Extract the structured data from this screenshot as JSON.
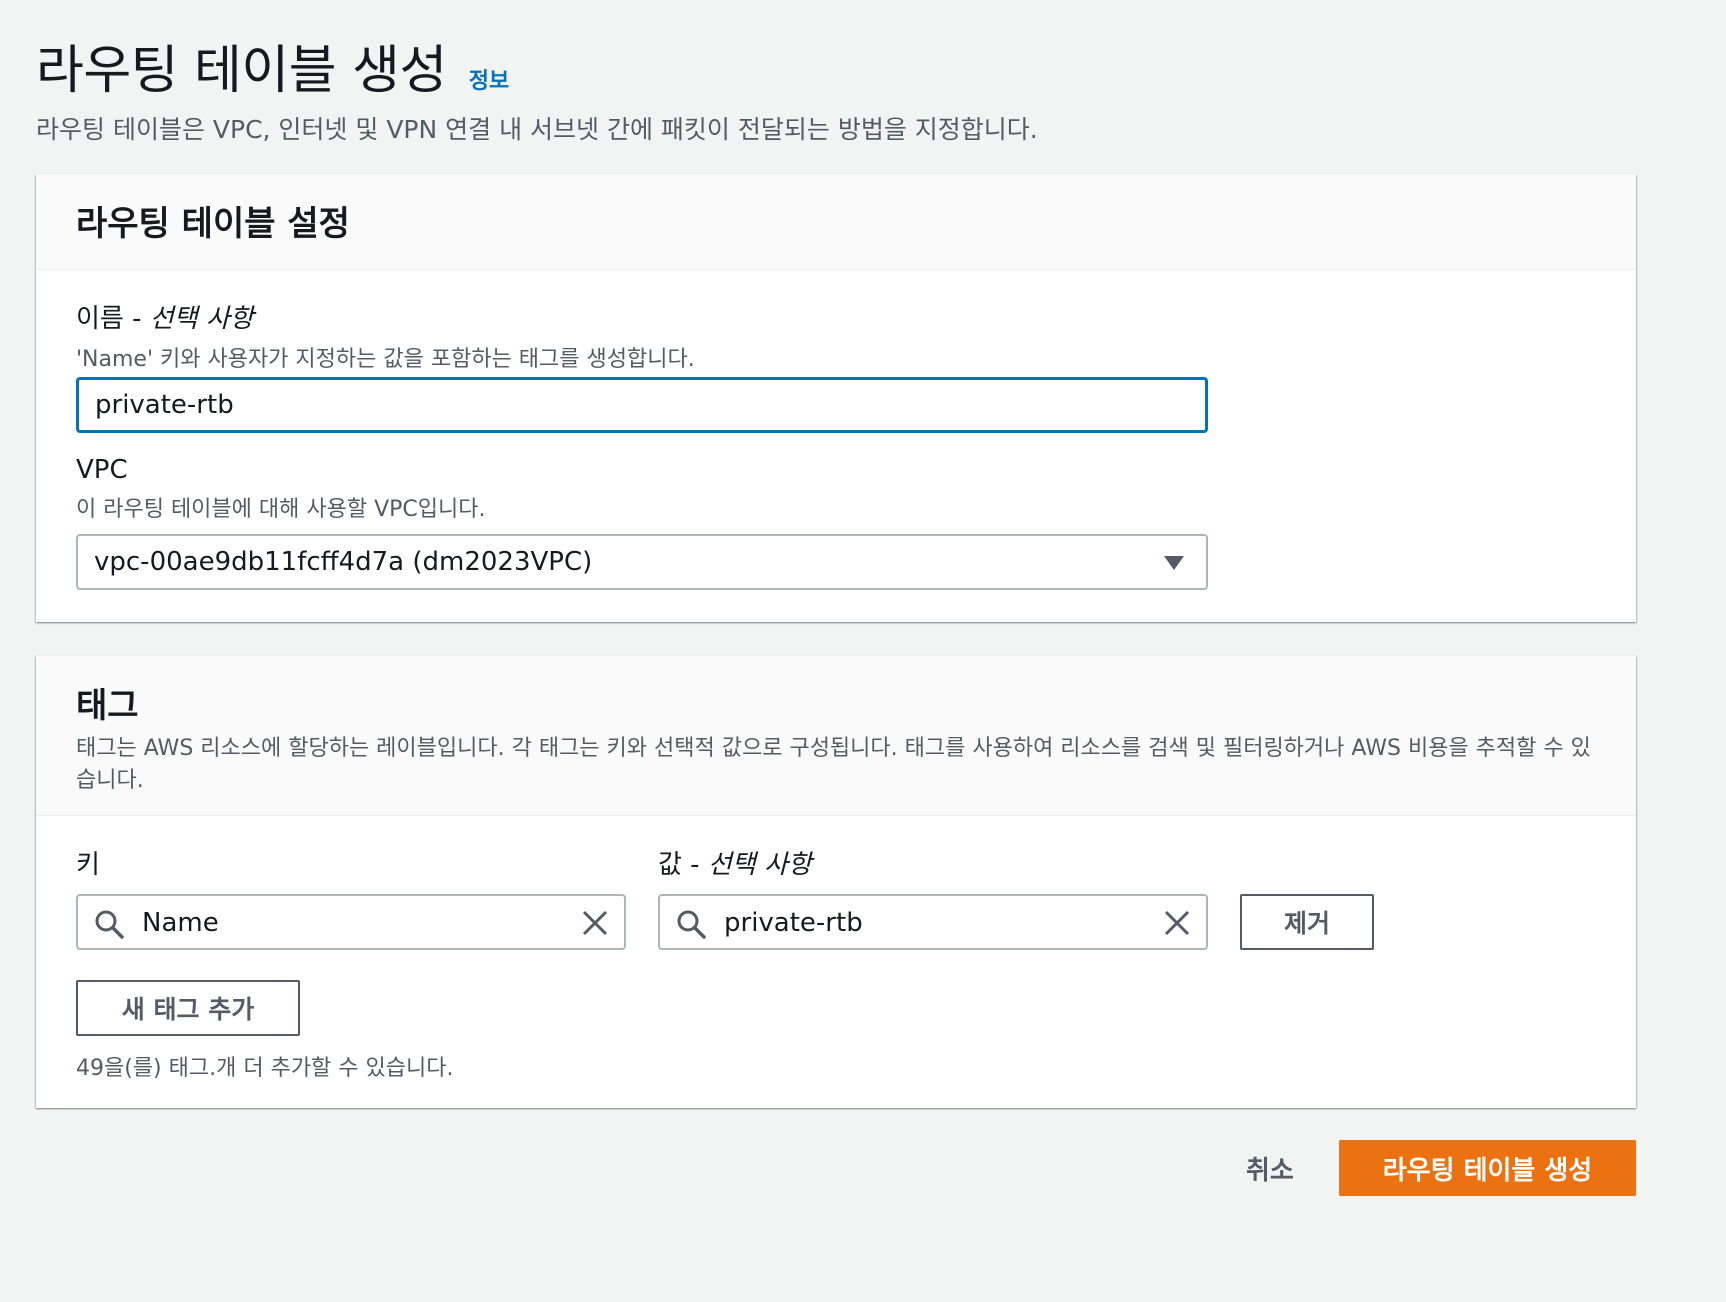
{
  "header": {
    "title": "라우팅 테이블 생성",
    "info_link": "정보",
    "description": "라우팅 테이블은 VPC, 인터넷 및 VPN 연결 내 서브넷 간에 패킷이 전달되는 방법을 지정합니다."
  },
  "settings": {
    "title": "라우팅 테이블 설정",
    "name_label": "이름 - ",
    "name_label_optional": "선택 사항",
    "name_hint": "'Name' 키와 사용자가 지정하는 값을 포함하는 태그를 생성합니다.",
    "name_value": "private-rtb",
    "vpc_label": "VPC",
    "vpc_hint": "이 라우팅 테이블에 대해 사용할 VPC입니다.",
    "vpc_selected": "vpc-00ae9db11fcff4d7a (dm2023VPC)"
  },
  "tags": {
    "title": "태그",
    "description": "태그는 AWS 리소스에 할당하는 레이블입니다. 각 태그는 키와 선택적 값으로 구성됩니다. 태그를 사용하여 리소스를 검색 및 필터링하거나 AWS 비용을 추적할 수 있습니다.",
    "key_label": "키",
    "value_label": "값 - ",
    "value_label_optional": "선택 사항",
    "rows": [
      {
        "key": "Name",
        "value": "private-rtb",
        "remove_label": "제거"
      }
    ],
    "add_button": "새 태그 추가",
    "remaining_text": "49을(를) 태그.개 더 추가할 수 있습니다."
  },
  "footer": {
    "cancel_label": "취소",
    "submit_label": "라우팅 테이블 생성"
  },
  "colors": {
    "primary": "#ec7211",
    "link": "#0073bb",
    "focus_border": "#0073bb",
    "background": "#f2f3f3"
  },
  "icons": [
    "search-icon",
    "clear-icon",
    "caret-down-icon"
  ]
}
